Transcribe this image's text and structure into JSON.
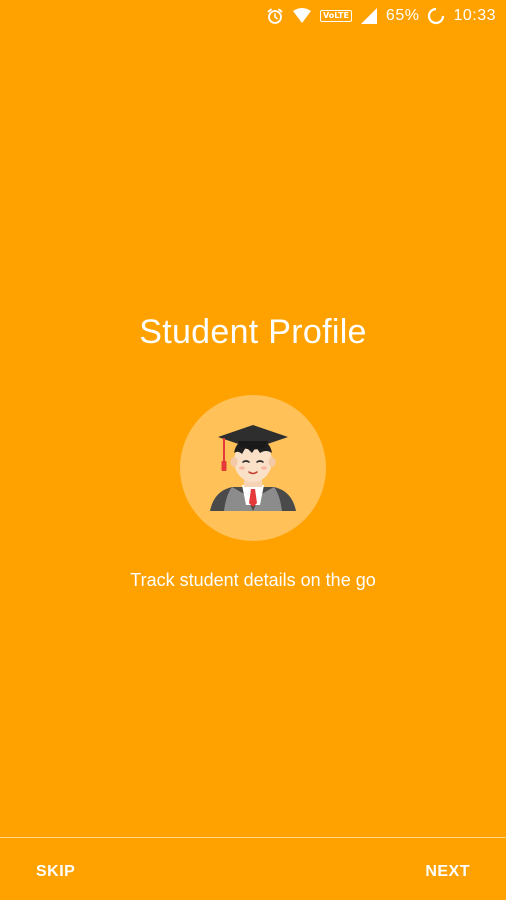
{
  "status_bar": {
    "icons": [
      "alarm-icon",
      "wifi-icon",
      "volte-icon",
      "signal-icon",
      "battery-icon"
    ],
    "volte_label": "VoLTE",
    "battery_percent": "65%",
    "time": "10:33"
  },
  "onboarding": {
    "title": "Student Profile",
    "illustration": "graduate-student-icon",
    "subtitle": "Track student details on the go"
  },
  "footer": {
    "skip_label": "SKIP",
    "next_label": "NEXT"
  },
  "colors": {
    "background": "#FFA200",
    "circle": "#FFC158",
    "text": "#FFFFFF"
  }
}
